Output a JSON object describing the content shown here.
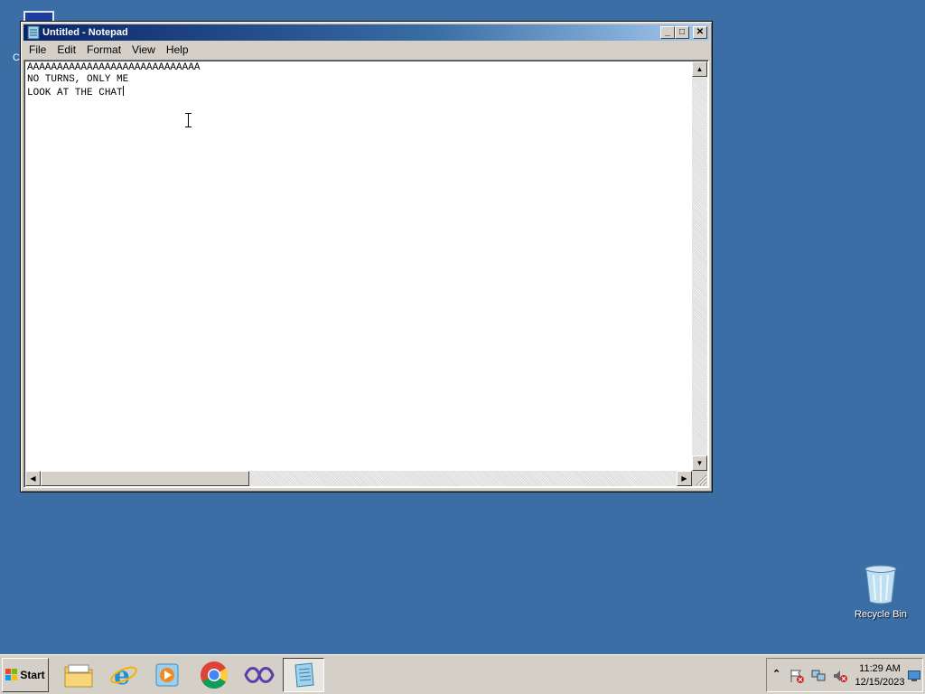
{
  "desktop": {
    "partial_icon_label": "C",
    "recycle_bin_label": "Recycle Bin"
  },
  "notepad": {
    "title": "Untitled - Notepad",
    "controls": {
      "minimize": "_",
      "maximize": "□",
      "close": "✕"
    },
    "menu": [
      "File",
      "Edit",
      "Format",
      "View",
      "Help"
    ],
    "lines": [
      "AAAAAAAAAAAAAAAAAAAAAAAAAAAAA",
      "NO TURNS, ONLY ME",
      "LOOK AT THE CHAT"
    ],
    "scroll_arrows": {
      "up": "▲",
      "down": "▼",
      "left": "◀",
      "right": "▶"
    }
  },
  "taskbar": {
    "start_label": "Start",
    "apps": [
      "file-explorer-icon",
      "internet-explorer-icon",
      "media-player-icon",
      "chrome-icon",
      "visual-studio-icon",
      "notepad-icon"
    ],
    "active_app": "notepad-icon",
    "tray_chevron": "⌃",
    "clock_time": "11:29 AM",
    "clock_date": "12/15/2023"
  },
  "colors": {
    "desktop": "#3a6ea5",
    "title_active": "#0a246a",
    "chrome": "#d4d0c8"
  }
}
